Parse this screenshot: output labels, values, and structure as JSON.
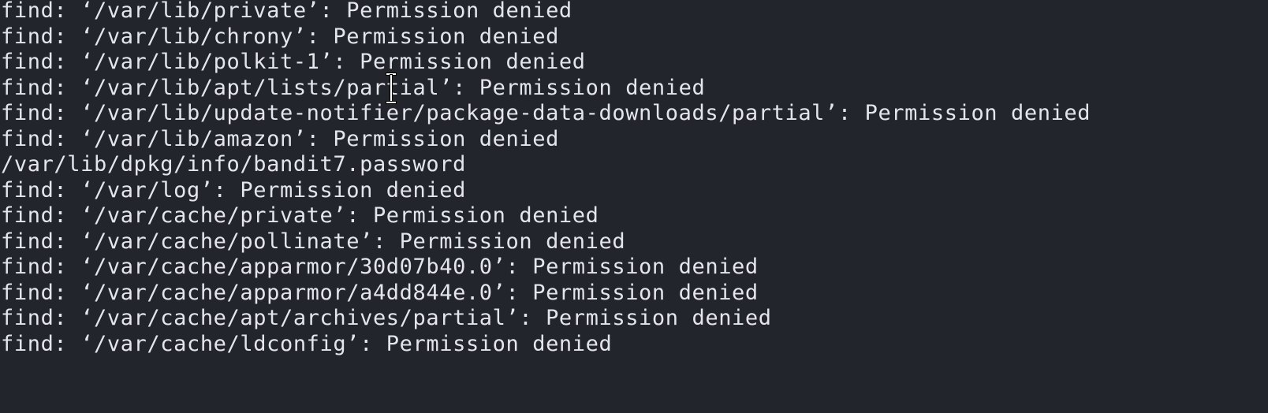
{
  "terminal": {
    "lines": [
      "find: ‘/var/lib/private’: Permission denied",
      "find: ‘/var/lib/chrony’: Permission denied",
      "find: ‘/var/lib/polkit-1’: Permission denied",
      "find: ‘/var/lib/apt/lists/partial’: Permission denied",
      "find: ‘/var/lib/update-notifier/package-data-downloads/partial’: Permission denied",
      "find: ‘/var/lib/amazon’: Permission denied",
      "/var/lib/dpkg/info/bandit7.password",
      "find: ‘/var/log’: Permission denied",
      "find: ‘/var/cache/private’: Permission denied",
      "find: ‘/var/cache/pollinate’: Permission denied",
      "find: ‘/var/cache/apparmor/30d07b40.0’: Permission denied",
      "find: ‘/var/cache/apparmor/a4dd844e.0’: Permission denied",
      "find: ‘/var/cache/apt/archives/partial’: Permission denied",
      "find: ‘/var/cache/ldconfig’: Permission denied"
    ],
    "cursor_icon": "text-cursor-ibeam-icon",
    "colors": {
      "background": "#23252d",
      "foreground": "#e4e6eb"
    }
  }
}
